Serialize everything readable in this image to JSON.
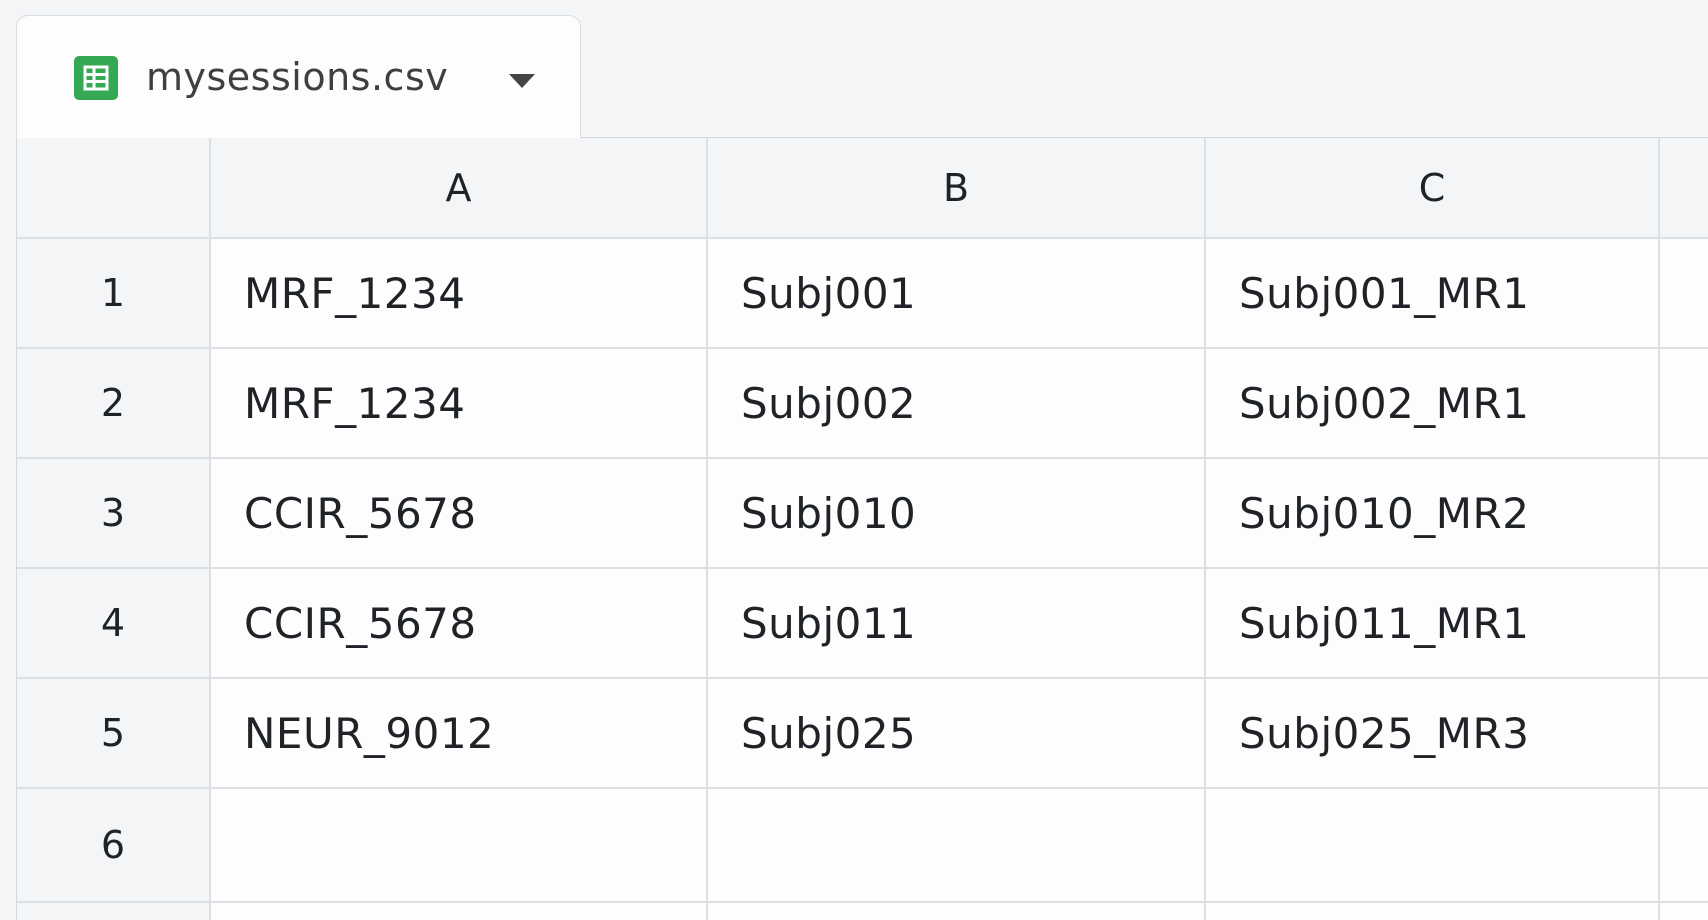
{
  "file_tab": {
    "title": "mysessions.csv",
    "icon": "sheets-icon",
    "icon_color": "#34a853",
    "menu_icon": "caret-down-icon"
  },
  "columns": [
    "A",
    "B",
    "C"
  ],
  "rows": [
    {
      "num": "1",
      "a": "MRF_1234",
      "b": "Subj001",
      "c": "Subj001_MR1"
    },
    {
      "num": "2",
      "a": "MRF_1234",
      "b": "Subj002",
      "c": "Subj002_MR1"
    },
    {
      "num": "3",
      "a": "CCIR_5678",
      "b": "Subj010",
      "c": "Subj010_MR2"
    },
    {
      "num": "4",
      "a": "CCIR_5678",
      "b": "Subj011",
      "c": "Subj011_MR1"
    },
    {
      "num": "5",
      "a": "NEUR_9012",
      "b": "Subj025",
      "c": "Subj025_MR3"
    },
    {
      "num": "6",
      "a": "",
      "b": "",
      "c": ""
    }
  ]
}
